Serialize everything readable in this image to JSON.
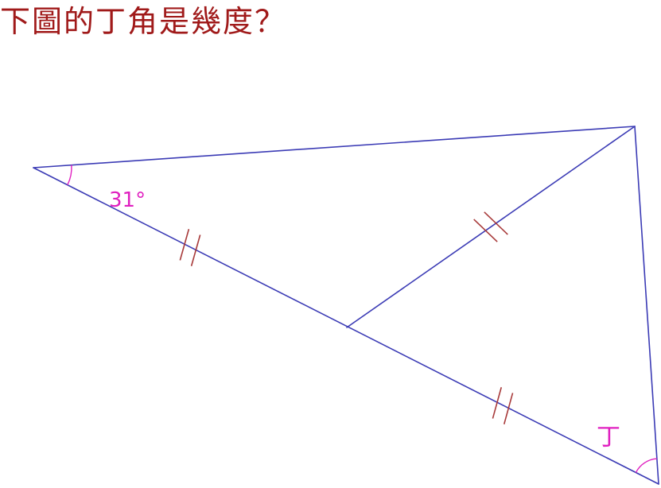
{
  "question": "下圖的丁角是幾度？",
  "angle_label": "31°",
  "unknown_label": "丁",
  "colors": {
    "question_text": "#a01a1a",
    "lines": "#3b3bb5",
    "ticks": "#a83a3a",
    "labels": "#e020c0"
  }
}
